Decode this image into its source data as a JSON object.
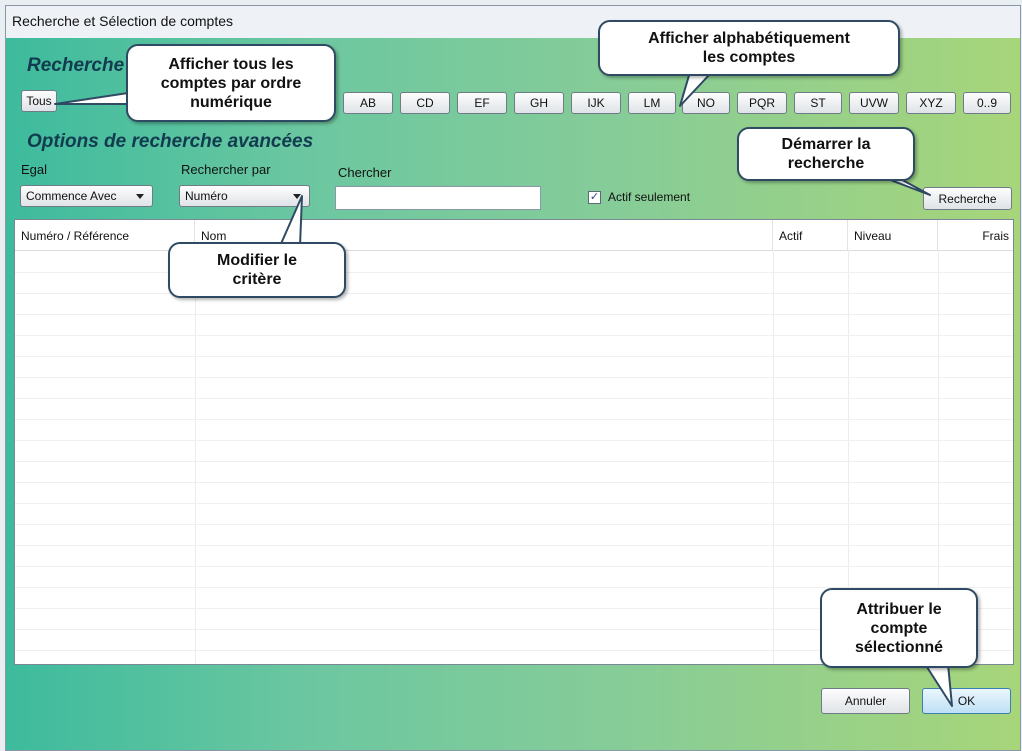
{
  "window": {
    "title": "Recherche et Sélection de comptes"
  },
  "search": {
    "section_title": "Recherche",
    "all_button": "Tous",
    "letter_buttons": [
      "AB",
      "CD",
      "EF",
      "GH",
      "IJK",
      "LM",
      "NO",
      "PQR",
      "ST",
      "UVW",
      "XYZ",
      "0..9"
    ]
  },
  "advanced": {
    "section_title": "Options de recherche avancées",
    "equal_label": "Egal",
    "equal_value": "Commence Avec",
    "searchby_label": "Rechercher par",
    "searchby_value": "Numéro",
    "search_label": "Chercher",
    "search_value": "",
    "active_only_label": "Actif seulement",
    "active_only_checked": true,
    "search_button": "Recherche"
  },
  "table": {
    "columns": [
      "Numéro / Référence",
      "Nom",
      "Actif",
      "Niveau",
      "Frais"
    ],
    "rows": []
  },
  "footer": {
    "cancel_label": "Annuler",
    "ok_label": "OK"
  },
  "callouts": {
    "show_all": "Afficher tous les comptes par ordre numérique",
    "alphabetical": "Afficher alphabétiquement les comptes",
    "start_search": "Démarrer la recherche",
    "modify_criteria": "Modifier le critère",
    "assign_account": "Attribuer le compte sélectionné"
  }
}
